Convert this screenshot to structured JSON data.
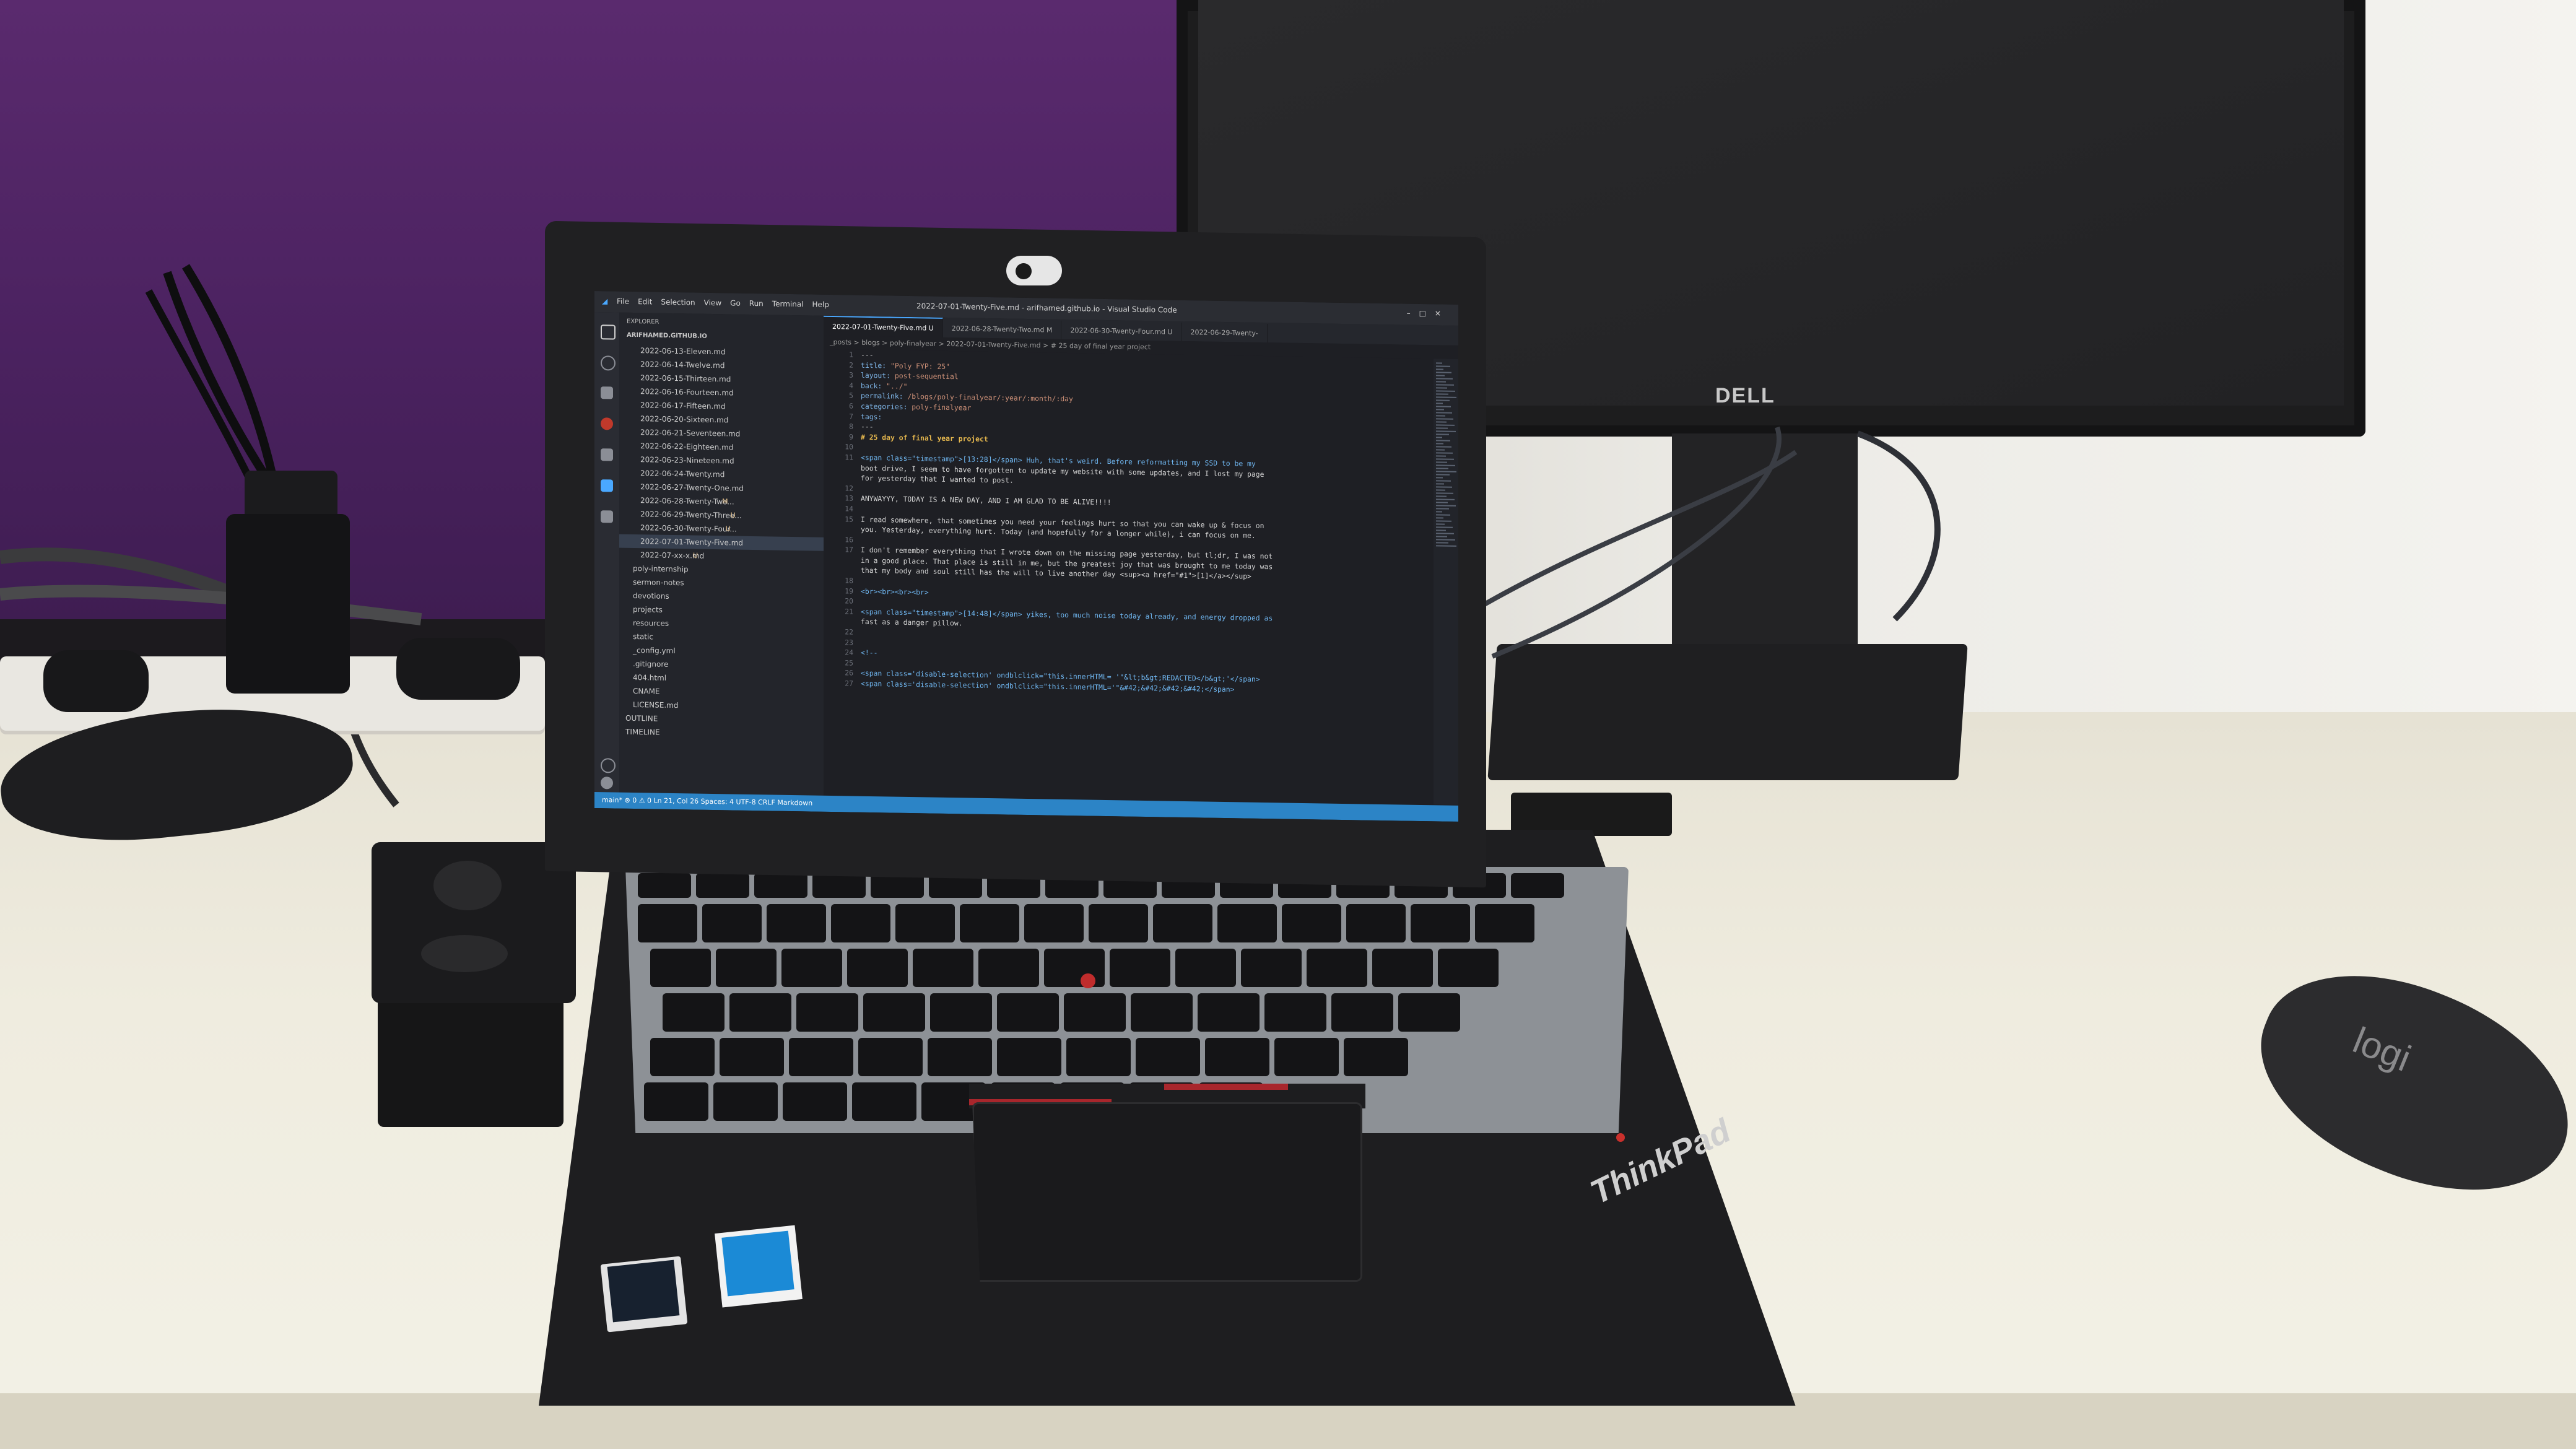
{
  "monitor": {
    "brand": "DELL"
  },
  "mouse": {
    "brand": "logi"
  },
  "laptop": {
    "brand": "ThinkPad",
    "stickers": {
      "intel": "CORE i5",
      "windows": "Windows"
    }
  },
  "vscode": {
    "window_title": "2022-07-01-Twenty-Five.md - arifhamed.github.io - Visual Studio Code",
    "menu": [
      "File",
      "Edit",
      "Selection",
      "View",
      "Go",
      "Run",
      "Terminal",
      "Help"
    ],
    "explorer": {
      "header": "EXPLORER",
      "root": "ARIFHAMED.GITHUB.IO",
      "files": [
        {
          "name": "2022-06-13-Eleven.md",
          "badge": ""
        },
        {
          "name": "2022-06-14-Twelve.md",
          "badge": ""
        },
        {
          "name": "2022-06-15-Thirteen.md",
          "badge": ""
        },
        {
          "name": "2022-06-16-Fourteen.md",
          "badge": ""
        },
        {
          "name": "2022-06-17-Fifteen.md",
          "badge": ""
        },
        {
          "name": "2022-06-20-Sixteen.md",
          "badge": ""
        },
        {
          "name": "2022-06-21-Seventeen.md",
          "badge": ""
        },
        {
          "name": "2022-06-22-Eighteen.md",
          "badge": ""
        },
        {
          "name": "2022-06-23-Nineteen.md",
          "badge": ""
        },
        {
          "name": "2022-06-24-Twenty.md",
          "badge": ""
        },
        {
          "name": "2022-06-27-Twenty-One.md",
          "badge": ""
        },
        {
          "name": "2022-06-28-Twenty-Two...",
          "badge": "M"
        },
        {
          "name": "2022-06-29-Twenty-Three...",
          "badge": "U"
        },
        {
          "name": "2022-06-30-Twenty-Four...",
          "badge": "U"
        },
        {
          "name": "2022-07-01-Twenty-Five.md",
          "badge": "U"
        },
        {
          "name": "2022-07-xx-x.md",
          "badge": "U"
        }
      ],
      "folders": [
        "poly-internship",
        "sermon-notes",
        "devotions",
        "projects",
        "resources",
        "static"
      ],
      "root_files": [
        "_config.yml",
        ".gitignore",
        "404.html",
        "CNAME",
        "LICENSE.md"
      ],
      "sections": [
        "OUTLINE",
        "TIMELINE"
      ]
    },
    "tabs": [
      {
        "label": "2022-07-01-Twenty-Five.md U",
        "active": true
      },
      {
        "label": "2022-06-28-Twenty-Two.md M",
        "active": false
      },
      {
        "label": "2022-06-30-Twenty-Four.md U",
        "active": false
      },
      {
        "label": "2022-06-29-Twenty-",
        "active": false
      }
    ],
    "breadcrumb": "_posts > blogs > poly-finalyear > 2022-07-01-Twenty-Five.md > # 25 day of final year project",
    "code_lines": [
      {
        "n": "1",
        "t": "---"
      },
      {
        "n": "2",
        "k": "title: ",
        "v": "\"Poly FYP: 25\""
      },
      {
        "n": "3",
        "k": "layout: ",
        "v": "post-sequential"
      },
      {
        "n": "4",
        "k": "back: ",
        "v": "\"../\""
      },
      {
        "n": "5",
        "k": "permalink: ",
        "v": "/blogs/poly-finalyear/:year/:month/:day"
      },
      {
        "n": "6",
        "k": "categories: ",
        "v": "poly-finalyear"
      },
      {
        "n": "7",
        "k": "tags:",
        "v": ""
      },
      {
        "n": "8",
        "t": "---"
      },
      {
        "n": "9",
        "h": "# 25 day of final year project"
      },
      {
        "n": "10",
        "t": ""
      },
      {
        "n": "11",
        "t": "<span class=\"timestamp\">[13:28]</span> Huh, that's weird. Before reformatting my SSD to be my"
      },
      {
        "n": "",
        "t": "boot drive, I seem to have forgotten to update my website with some updates, and I lost my page"
      },
      {
        "n": "",
        "t": "for yesterday that I wanted to post."
      },
      {
        "n": "12",
        "t": ""
      },
      {
        "n": "13",
        "t": "ANYWAYYY, TODAY IS A NEW DAY, AND I AM GLAD TO BE ALIVE!!!!"
      },
      {
        "n": "14",
        "t": ""
      },
      {
        "n": "15",
        "t": "I read somewhere, that sometimes you need your feelings hurt so that you can wake up & focus on"
      },
      {
        "n": "",
        "t": "you. Yesterday, everything hurt. Today (and hopefully for a longer while), i can focus on me."
      },
      {
        "n": "16",
        "t": ""
      },
      {
        "n": "17",
        "t": "I don't remember everything that I wrote down on the missing page yesterday, but tl;dr, I was not"
      },
      {
        "n": "",
        "t": "in a good place. That place is still in me, but the greatest joy that was brought to me today was"
      },
      {
        "n": "",
        "t": "that my body and soul still has the will to live another day <sup><a href=\"#1\">[1]</a></sup>"
      },
      {
        "n": "18",
        "t": ""
      },
      {
        "n": "19",
        "t": "<br><br><br><br>"
      },
      {
        "n": "20",
        "t": ""
      },
      {
        "n": "21",
        "t": "<span class=\"timestamp\">[14:48]</span> yikes, too much noise today already, and energy dropped as"
      },
      {
        "n": "",
        "t": "fast as a danger pillow."
      },
      {
        "n": "22",
        "t": ""
      },
      {
        "n": "23",
        "t": ""
      },
      {
        "n": "24",
        "t": "<!--"
      },
      {
        "n": "25",
        "t": ""
      },
      {
        "n": "26",
        "t": "<span class='disable-selection' ondblclick=\"this.innerHTML= '\"&lt;b&gt;REDACTED</b&gt;'</span>"
      },
      {
        "n": "27",
        "t": "<span class='disable-selection' ondblclick=\"this.innerHTML='\"&#42;&#42;&#42;&#42;</span>"
      }
    ],
    "status_bar": "main*  ⊗ 0 ⚠ 0    Ln 21, Col 26   Spaces: 4   UTF-8   CRLF   Markdown"
  }
}
